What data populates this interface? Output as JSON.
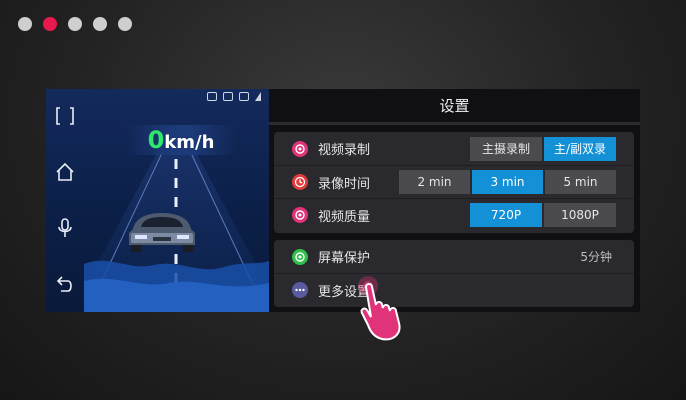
{
  "carousel": {
    "dots": 5,
    "active_index": 1
  },
  "left_panel": {
    "speed_value": "0",
    "speed_unit": "km/h",
    "nav_icons": [
      "fullscreen-icon",
      "home-icon",
      "microphone-icon",
      "back-icon"
    ]
  },
  "settings": {
    "title": "设置",
    "video_recording": {
      "label": "视频录制",
      "options": [
        "主摄录制",
        "主/副双录"
      ],
      "selected": "主/副双录"
    },
    "recording_time": {
      "label": "录像时间",
      "options": [
        "2 min",
        "3 min",
        "5 min"
      ],
      "selected": "3 min"
    },
    "video_quality": {
      "label": "视频质量",
      "options": [
        "720P",
        "1080P"
      ],
      "selected": "720P"
    },
    "screensaver": {
      "label": "屏幕保护",
      "value": "5分钟"
    },
    "more_settings": {
      "label": "更多设置"
    }
  },
  "colors": {
    "accent": "#1390d6",
    "speed": "#2ee86b",
    "active_dot": "#e8194d",
    "pink_icon": "#e0337a",
    "red_icon": "#e23a3a",
    "green_icon": "#2fbf4a",
    "gray_icon": "#5a5aa0"
  }
}
